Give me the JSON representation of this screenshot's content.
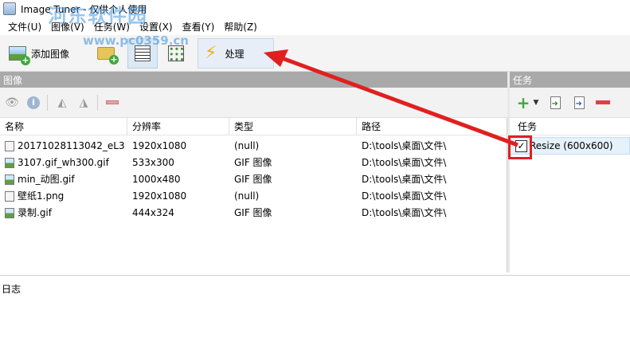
{
  "window": {
    "title": "Image Tuner - 仅供个人使用"
  },
  "watermark": {
    "site_name": "河东软件园",
    "url": "www.pc0359.cn"
  },
  "menu": [
    {
      "label": "文件(U)"
    },
    {
      "label": "图像(V)"
    },
    {
      "label": "任务(W)"
    },
    {
      "label": "设置(X)"
    },
    {
      "label": "查看(Y)"
    },
    {
      "label": "帮助(Z)"
    }
  ],
  "toolbar": {
    "add_image_label": "添加图像",
    "add_folder_icon": "add-folder-icon",
    "list_view_icon": "list-view-icon",
    "thumb_view_icon": "thumbnail-view-icon",
    "process_label": "处理"
  },
  "images_panel": {
    "header": "图像",
    "columns": [
      "名称",
      "分辨率",
      "类型",
      "路径"
    ],
    "rows": [
      {
        "icon": "file",
        "name": "20171028113042_eL3...",
        "resolution": "1920x1080",
        "type": "(null)",
        "path": "D:\\tools\\桌面\\文件\\"
      },
      {
        "icon": "image",
        "name": "3107.gif_wh300.gif",
        "resolution": "533x300",
        "type": "GIF 图像",
        "path": "D:\\tools\\桌面\\文件\\"
      },
      {
        "icon": "image",
        "name": "min_动图.gif",
        "resolution": "1000x480",
        "type": "GIF 图像",
        "path": "D:\\tools\\桌面\\文件\\"
      },
      {
        "icon": "file",
        "name": "壁纸1.png",
        "resolution": "1920x1080",
        "type": "(null)",
        "path": "D:\\tools\\桌面\\文件\\"
      },
      {
        "icon": "image",
        "name": "录制.gif",
        "resolution": "444x324",
        "type": "GIF 图像",
        "path": "D:\\tools\\桌面\\文件\\"
      }
    ]
  },
  "tasks_panel": {
    "header": "任务",
    "column": "任务",
    "items": [
      {
        "label": "Resize (600x600)",
        "checked": true
      }
    ]
  },
  "log_panel": {
    "label": "日志"
  },
  "colors": {
    "annotation": "#e02020",
    "panel_header": "#a9a9a9",
    "selection": "#e5f1fb"
  }
}
